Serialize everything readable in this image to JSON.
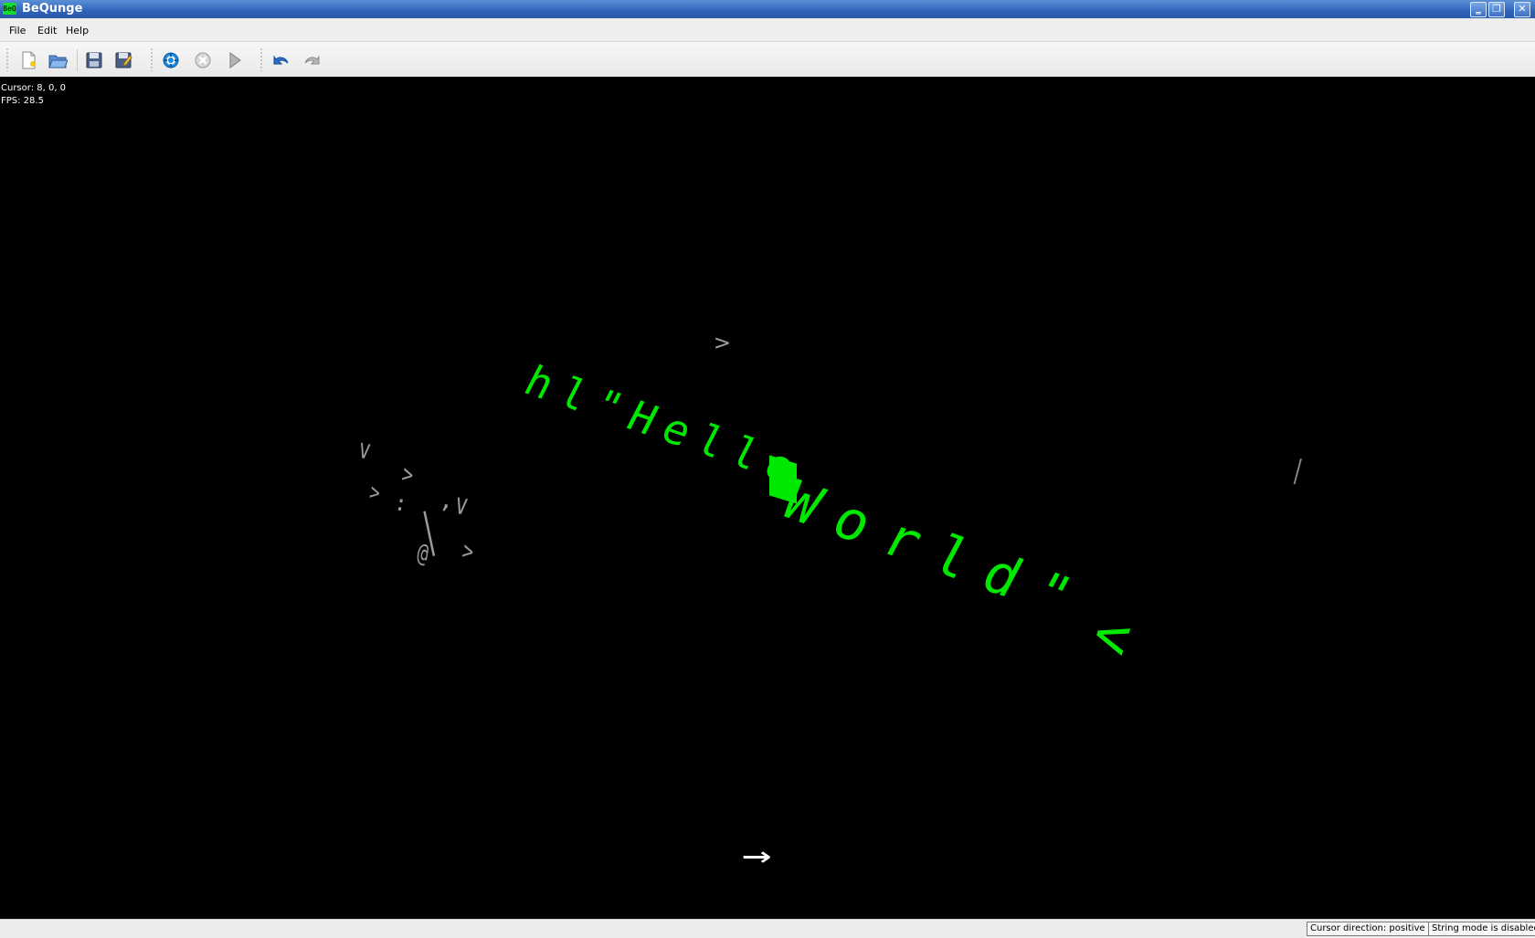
{
  "window": {
    "title": "BeQunge",
    "app_icon_text": "BeQ"
  },
  "menu": {
    "items": [
      "File",
      "Edit",
      "Help"
    ]
  },
  "toolbar": {
    "buttons": [
      {
        "name": "new-file-icon"
      },
      {
        "name": "open-folder-icon"
      },
      {
        "name": "save-icon"
      },
      {
        "name": "save-as-icon"
      },
      {
        "name": "run-icon"
      },
      {
        "name": "stop-icon"
      },
      {
        "name": "step-icon"
      },
      {
        "name": "undo-icon"
      },
      {
        "name": "redo-icon"
      }
    ]
  },
  "hud": {
    "cursor": "Cursor: 8, 0, 0",
    "fps": "FPS: 28.5"
  },
  "scene": {
    "line_left": "hl\"Hello",
    "line_right": "World\"",
    "arrow_left": "<",
    "grey_arrow_top": ">",
    "grey_underscore": "_",
    "grey_cluster": [
      "v",
      ">",
      ">",
      ":",
      "|",
      ",",
      "v",
      "@",
      ">"
    ],
    "direction_indicator": "→"
  },
  "status": {
    "direction": "Cursor direction: positive x",
    "string_mode": "String mode is disabled"
  },
  "colors": {
    "green": "#00e800",
    "grey": "#9a9a9a",
    "title_bar": "#2f63b8"
  }
}
